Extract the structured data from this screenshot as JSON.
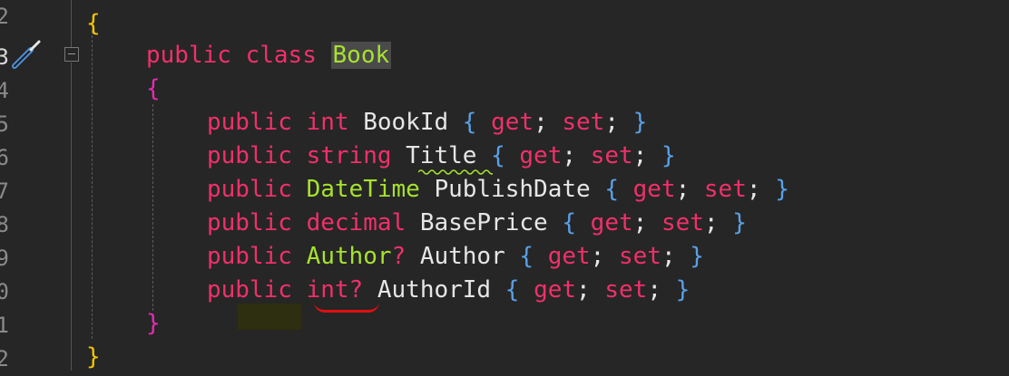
{
  "colors": {
    "background": "#262626",
    "keyword": "#f0306a",
    "type": "#a6e22e",
    "identifier": "#e6e6e6",
    "accessor_brace": "#5aa0e6",
    "namespace_brace": "#f4c400",
    "class_brace": "#e62bb0",
    "line_number": "#8a8a8a",
    "warning_squiggle": "#a6e22e",
    "error_squiggle": "#e01010"
  },
  "gutter": {
    "line_numbers": [
      "2",
      "3",
      "4",
      "5",
      "6",
      "7",
      "8",
      "9",
      "0",
      "1",
      "2"
    ],
    "active_line_number": "3",
    "gutter_icon": "screwdriver-icon",
    "fold_icon": "collapse-icon"
  },
  "code": {
    "ns_open": "{",
    "ns_close": "}",
    "class_decl": {
      "kw1": "public",
      "kw2": "class",
      "name": "Book"
    },
    "class_open": "{",
    "class_close": "}",
    "accessors": {
      "open": "{",
      "get": "get",
      "semi1": ";",
      "set": "set",
      "semi2": ";",
      "close": "}"
    },
    "properties": [
      {
        "modifier": "public",
        "type": "int",
        "type_style": "keyword",
        "name": "BookId"
      },
      {
        "modifier": "public",
        "type": "string",
        "type_style": "keyword",
        "name": "Title"
      },
      {
        "modifier": "public",
        "type": "DateTime",
        "type_style": "type",
        "name": "PublishDate"
      },
      {
        "modifier": "public",
        "type": "decimal",
        "type_style": "keyword",
        "name": "BasePrice"
      },
      {
        "modifier": "public",
        "type": "Author",
        "nullable": "?",
        "type_style": "type",
        "name": "Author"
      },
      {
        "modifier": "public",
        "type": "int?",
        "type_style": "keyword",
        "name": "AuthorId"
      }
    ]
  }
}
